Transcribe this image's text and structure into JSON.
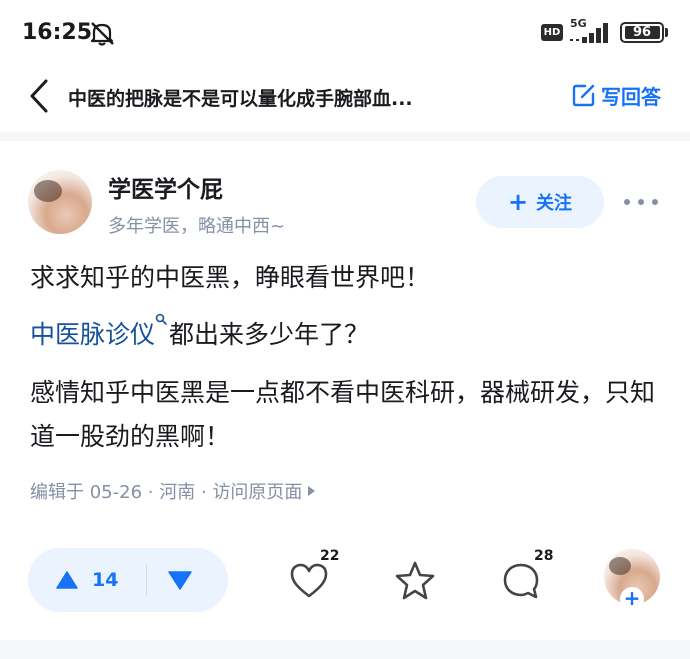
{
  "status_bar": {
    "time": "16:25",
    "network": "5G",
    "hd_badge": "HD",
    "battery": "96",
    "battery_level": 0.96
  },
  "nav": {
    "title": "中医的把脉是不是可以量化成手腕部血...",
    "write_answer_label": "写回答"
  },
  "author": {
    "name": "学医学个屁",
    "bio": "多年学医，略通中西~",
    "follow_label": "关注",
    "follow_plus": "+"
  },
  "content": {
    "p1": "求求知乎的中医黑，睁眼看世界吧！",
    "p2_link": "中医脉诊仪",
    "p2_rest": "都出来多少年了？",
    "p3": "感情知乎中医黑是一点都不看中医科研，器械研发，只知道一股劲的黑啊！"
  },
  "meta": {
    "edited": "编辑于 05-26",
    "sep": "·",
    "location": "河南",
    "visit_label": "访问原页面"
  },
  "actions": {
    "upvotes": "14",
    "likes": "22",
    "comments": "28",
    "add_plus": "+"
  },
  "colors": {
    "accent": "#1772f6",
    "accent_bg": "#ebf3fe",
    "link": "#175199",
    "muted": "#8590a6",
    "text": "#191b1f"
  },
  "icons": [
    "mute-icon",
    "signal-icon",
    "battery-icon",
    "back-icon",
    "edit-icon",
    "plus-icon",
    "more-icon",
    "search-mini-icon",
    "upvote-icon",
    "downvote-icon",
    "heart-icon",
    "star-icon",
    "comment-icon"
  ]
}
